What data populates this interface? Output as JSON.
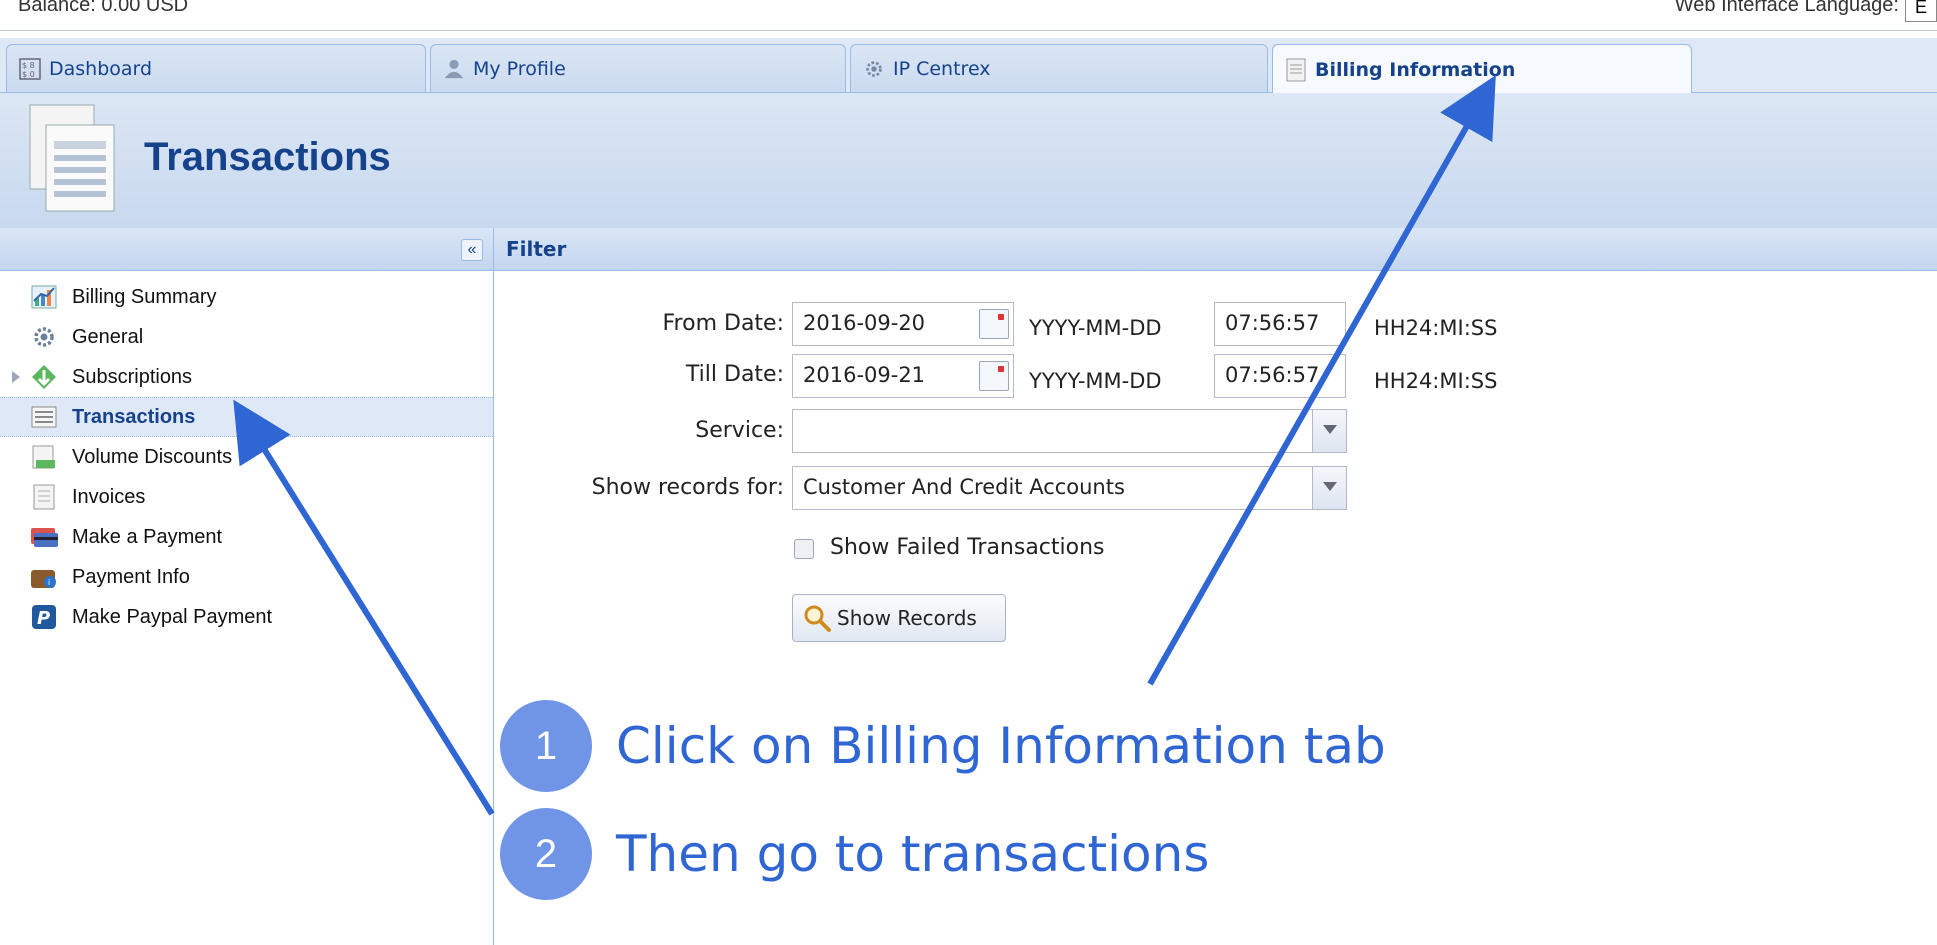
{
  "topbar": {
    "balance": "Balance: 0.00 USD",
    "language_label": "Web Interface Language:",
    "language_value": "E"
  },
  "tabs": [
    {
      "label": "Dashboard",
      "icon": "dashboard-icon",
      "active": false
    },
    {
      "label": "My Profile",
      "icon": "user-icon",
      "active": false
    },
    {
      "label": "IP Centrex",
      "icon": "gear-icon",
      "active": false
    },
    {
      "label": "Billing Information",
      "icon": "document-icon",
      "active": true
    }
  ],
  "header": {
    "title": "Transactions",
    "icon": "transactions-doc-icon"
  },
  "sidebar": {
    "collapse_label": "«",
    "items": [
      {
        "label": "Billing Summary",
        "icon": "chart-icon"
      },
      {
        "label": "General",
        "icon": "gear-icon"
      },
      {
        "label": "Subscriptions",
        "icon": "subscriptions-icon"
      },
      {
        "label": "Transactions",
        "icon": "transactions-icon",
        "selected": true
      },
      {
        "label": "Volume Discounts",
        "icon": "discount-icon"
      },
      {
        "label": "Invoices",
        "icon": "invoice-icon"
      },
      {
        "label": "Make a Payment",
        "icon": "credit-card-icon"
      },
      {
        "label": "Payment Info",
        "icon": "wallet-icon"
      },
      {
        "label": "Make Paypal Payment",
        "icon": "paypal-icon"
      }
    ]
  },
  "filter": {
    "title": "Filter",
    "from_label": "From Date:",
    "from_date": "2016-09-20",
    "from_time": "07:56:57",
    "till_label": "Till Date:",
    "till_date": "2016-09-21",
    "till_time": "07:56:57",
    "date_format": "YYYY-MM-DD",
    "time_format": "HH24:MI:SS",
    "service_label": "Service:",
    "service_value": "",
    "show_for_label": "Show records for:",
    "show_for_value": "Customer And Credit Accounts",
    "failed_label": "Show Failed Transactions",
    "failed_checked": false,
    "show_records_label": "Show Records"
  },
  "annotations": [
    {
      "number": "1",
      "text": "Click on Billing Information tab"
    },
    {
      "number": "2",
      "text": "Then go to transactions"
    }
  ],
  "colors": {
    "accent": "#15428b",
    "annotation_blue": "#7195e6",
    "annotation_text": "#2f66d3",
    "arrow": "#2f66d3"
  }
}
